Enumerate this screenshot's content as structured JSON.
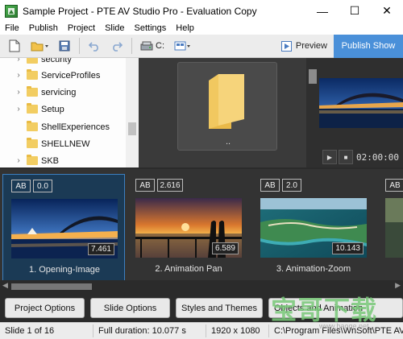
{
  "window": {
    "title": "Sample Project - PTE AV Studio Pro - Evaluation Copy",
    "minimize": "—",
    "maximize": "☐",
    "close": "✕"
  },
  "menu": [
    "File",
    "Publish",
    "Project",
    "Slide",
    "Settings",
    "Help"
  ],
  "toolbar": {
    "drive_label": "C:",
    "preview_label": "Preview",
    "publish_label": "Publish Show",
    "icons": [
      "new-file-icon",
      "open-folder-icon",
      "save-icon",
      "undo-icon",
      "redo-icon",
      "drive-icon",
      "view-mode-icon"
    ]
  },
  "folders": [
    {
      "name": "security",
      "expandable": true
    },
    {
      "name": "ServiceProfiles",
      "expandable": true
    },
    {
      "name": "servicing",
      "expandable": true
    },
    {
      "name": "Setup",
      "expandable": true
    },
    {
      "name": "ShellExperiences",
      "expandable": false
    },
    {
      "name": "SHELLNEW",
      "expandable": false
    },
    {
      "name": "SKB",
      "expandable": true
    }
  ],
  "files_panel": {
    "parent_label": ".."
  },
  "preview": {
    "time": "02:00:00"
  },
  "slides": [
    {
      "label": "1. Opening-Image",
      "ab": "AB",
      "start": "0.0",
      "duration": "7.461",
      "selected": true,
      "scene": "harbour"
    },
    {
      "label": "2. Animation Pan",
      "ab": "AB",
      "start": "2.616",
      "duration": "6.589",
      "selected": false,
      "scene": "sunset"
    },
    {
      "label": "3. Animation-Zoom",
      "ab": "AB",
      "start": "2.0",
      "duration": "10.143",
      "selected": false,
      "scene": "island"
    },
    {
      "label": "",
      "ab": "AB",
      "start": "",
      "duration": "",
      "selected": false,
      "scene": "partial"
    }
  ],
  "buttons": {
    "project_options": "Project Options",
    "slide_options": "Slide Options",
    "styles_themes": "Styles and Themes",
    "objects_animation": "Objects and Animation"
  },
  "status": {
    "slide": "Slide 1 of 16",
    "duration": "Full duration: 10.077 s",
    "resolution": "1920 x 1080",
    "path": "C:\\Program Files\\WnSoft\\PTE AV"
  },
  "watermark": {
    "text": "宝哥下载",
    "url": "www.baoge.net"
  },
  "colors": {
    "accent": "#4a90d9",
    "selection": "#3c7fc0",
    "dark_panel": "#333333"
  }
}
